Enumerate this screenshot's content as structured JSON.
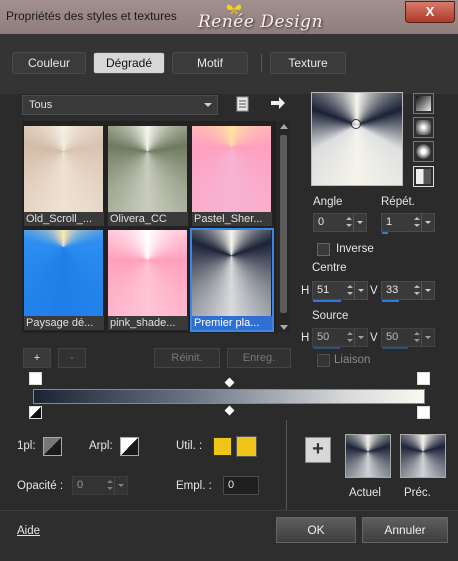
{
  "window": {
    "title": "Propriétés des styles et textures",
    "brand": "Renée Design",
    "close_label": "X"
  },
  "tabs": [
    {
      "label": "Couleur",
      "active": false
    },
    {
      "label": "Dégradé",
      "active": true
    },
    {
      "label": "Motif",
      "active": false
    },
    {
      "label": "Texture",
      "active": false
    }
  ],
  "category_select": {
    "value": "Tous"
  },
  "gradients": [
    {
      "name": "Old_Scroll_...",
      "selected": false
    },
    {
      "name": "Olivera_CC",
      "selected": false
    },
    {
      "name": "Pastel_Sher...",
      "selected": false
    },
    {
      "name": "Paysage dé...",
      "selected": false
    },
    {
      "name": "pink_shade...",
      "selected": false
    },
    {
      "name": "Premier pla...",
      "selected": true
    }
  ],
  "list_buttons": {
    "add": "+",
    "remove": "-",
    "reset": "Réinit.",
    "save": "Enreg."
  },
  "settings": {
    "angle_label": "Angle",
    "angle_value": "0",
    "repeat_label": "Répét.",
    "repeat_value": "1",
    "invert_label": "Inverse",
    "center_label": "Centre",
    "center_h_label": "H",
    "center_h_value": "51",
    "center_v_label": "V",
    "center_v_value": "33",
    "source_label": "Source",
    "source_h_label": "H",
    "source_h_value": "50",
    "source_v_label": "V",
    "source_v_value": "50",
    "link_label": "Liaison"
  },
  "stops": {
    "fill_label": "1pl:",
    "arpl_label": "Arpl:",
    "util_label": "Util. :",
    "opacity_label": "Opacité :",
    "opacity_value": "0",
    "empl_label": "Empl. :",
    "empl_value": "0",
    "accent_color": "#f0c419"
  },
  "compare": {
    "current_label": "Actuel",
    "previous_label": "Préc."
  },
  "footer": {
    "help": "Aide",
    "ok": "OK",
    "cancel": "Annuler"
  }
}
